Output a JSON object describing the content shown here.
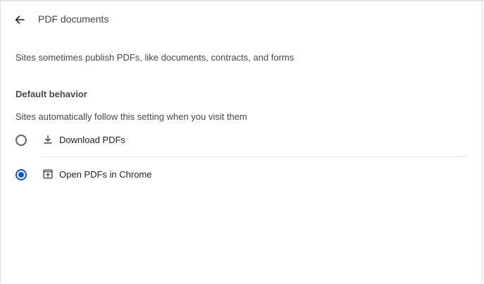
{
  "header": {
    "back_icon": "arrow-back-icon",
    "title": "PDF documents"
  },
  "description": "Sites sometimes publish PDFs, like documents, contracts, and forms",
  "default_behavior": {
    "heading": "Default behavior",
    "subtitle": "Sites automatically follow this setting when you visit them",
    "options": [
      {
        "label": "Download PDFs",
        "icon": "download-icon",
        "selected": false
      },
      {
        "label": "Open PDFs in Chrome",
        "icon": "open-in-new-icon",
        "selected": true
      }
    ]
  },
  "colors": {
    "accent": "#0b57d0",
    "text": "#1f1f1f",
    "secondary_text": "#474747"
  }
}
